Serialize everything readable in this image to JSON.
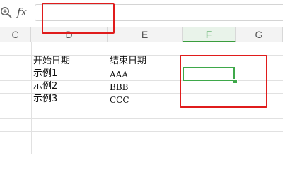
{
  "formula_bar": {
    "fx_label": "fx",
    "input_value": ""
  },
  "columns": [
    "C",
    "D",
    "E",
    "F",
    "G"
  ],
  "active_column": "F",
  "cells": {
    "D2": "开始日期",
    "E2": "结束日期",
    "D3": "示例1",
    "E3": "AAA",
    "D4": "示例2",
    "E4": "BBB",
    "D5": "示例3",
    "E5": "CCC"
  },
  "colors": {
    "selection": "#3ea84a",
    "annotation": "#e01c1c"
  }
}
